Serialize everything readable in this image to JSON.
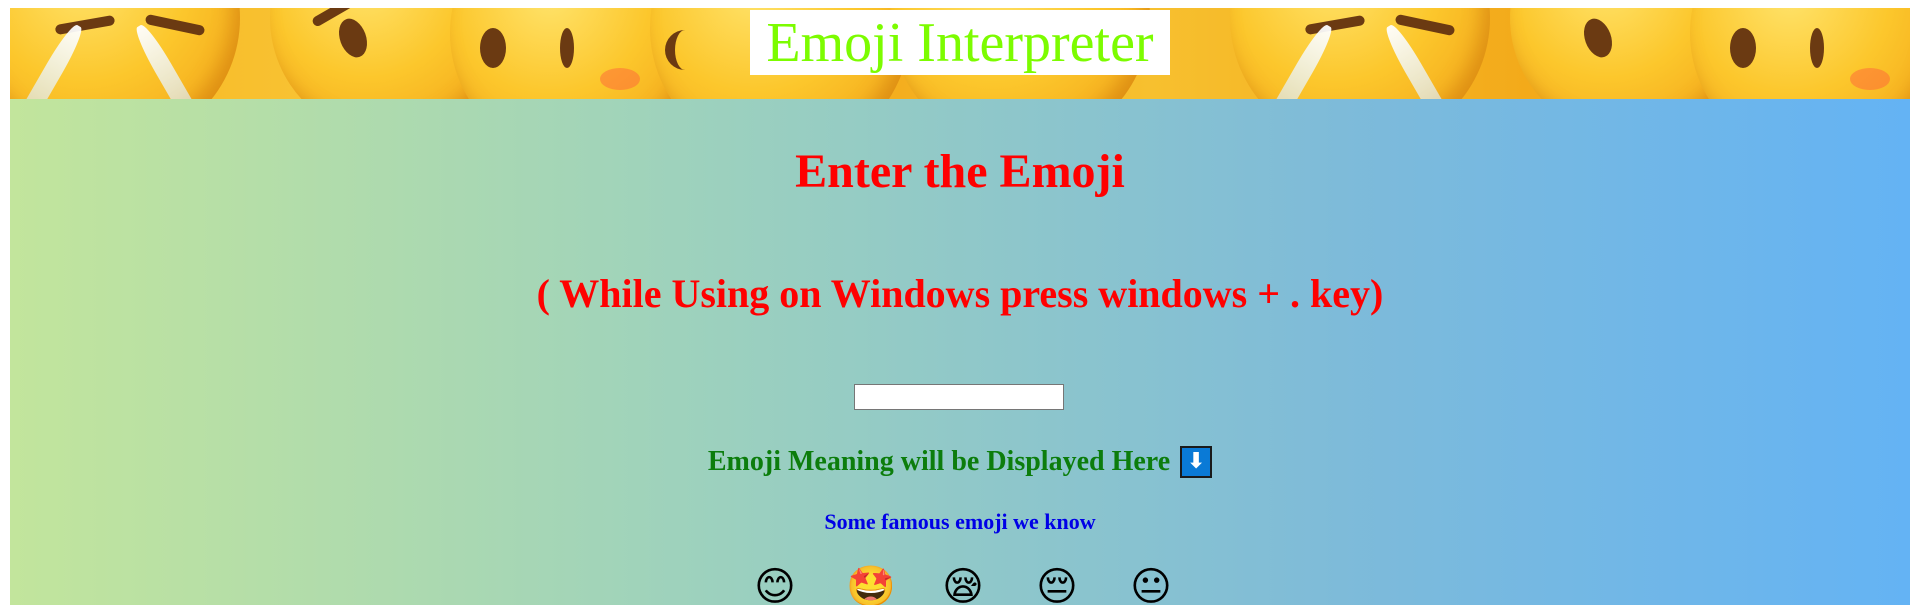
{
  "header": {
    "title": "Emoji Interpreter",
    "title_color": "#7cfc00",
    "banner_icon": "emoji-faces-banner"
  },
  "main": {
    "heading": "Enter the Emoji",
    "hint": "( While Using on Windows press windows + . key)",
    "heading_color": "#ff0000",
    "input": {
      "value": "",
      "placeholder": ""
    },
    "meaning": {
      "text": "Emoji Meaning will be Displayed Here",
      "arrow": "⬇",
      "arrow_icon": "down-arrow-icon",
      "color": "#0c7d0c"
    },
    "famous": {
      "label": "Some famous emoji we know",
      "color": "#0000e6",
      "emojis": [
        "😊",
        "🤩",
        "😪",
        "😔",
        "😐"
      ]
    },
    "background": {
      "gradient_start": "#c2e59c",
      "gradient_end": "#64b3f4"
    }
  }
}
